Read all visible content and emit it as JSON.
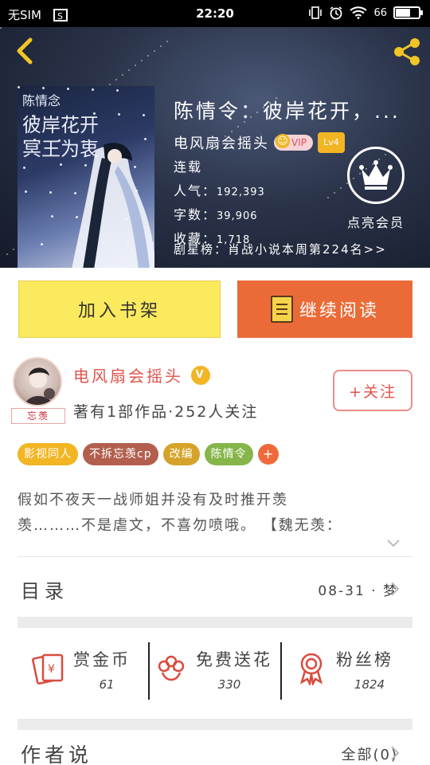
{
  "status_bar": {
    "carrier": "无SIM",
    "time": "22:20",
    "battery_text": "66",
    "battery_level": 0.66
  },
  "header": {
    "back_icon": "back-arrow-icon",
    "share_icon": "share-icon",
    "cover_lines": [
      "陈情念",
      "彼岸花开",
      "冥王为衷"
    ],
    "book_title": "陈情令：彼岸花开，...",
    "author": "电风扇会摇头",
    "vip_label": "VIP",
    "level_label": "Lv4",
    "status": "连载",
    "popularity_label": "人气：",
    "popularity_value": "192,393",
    "word_count_label": "字数：",
    "word_count_value": "39,906",
    "favorites_label": "收藏：",
    "favorites_value": "1,718",
    "rank_text": "剧星榜：肖战小说本周第224名>>",
    "member_label": "点亮会员"
  },
  "actions": {
    "add_to_shelf": "加入书架",
    "continue_reading": "继续阅读"
  },
  "author_card": {
    "avatar_tag": "忘羡",
    "name": "电风扇会摇头",
    "verified_label": "V",
    "stats": "著有1部作品·252人关注",
    "follow_button": "+关注"
  },
  "tags": [
    {
      "label": "影视同人",
      "color": "#f2b523"
    },
    {
      "label": "不拆忘羡cp",
      "color": "#b35f4e"
    },
    {
      "label": "改编",
      "color": "#d5a32a"
    },
    {
      "label": "陈情令",
      "color": "#86b54a"
    }
  ],
  "tag_add": "+",
  "synopsis": {
    "line1": "假如不夜天一战师姐并没有及时推开羡",
    "line2": "羡………不是虐文，不喜勿喷哦。 【魏无羡："
  },
  "toc": {
    "title": "目录",
    "latest": "08-31 · 梦"
  },
  "stats": [
    {
      "title": "赏金币",
      "value": "61",
      "icon": "red-envelope-icon"
    },
    {
      "title": "免费送花",
      "value": "330",
      "icon": "flower-icon"
    },
    {
      "title": "粉丝榜",
      "value": "1824",
      "icon": "award-medal-icon"
    }
  ],
  "author_says": {
    "title": "作者说",
    "all_label": "全部(0)"
  }
}
